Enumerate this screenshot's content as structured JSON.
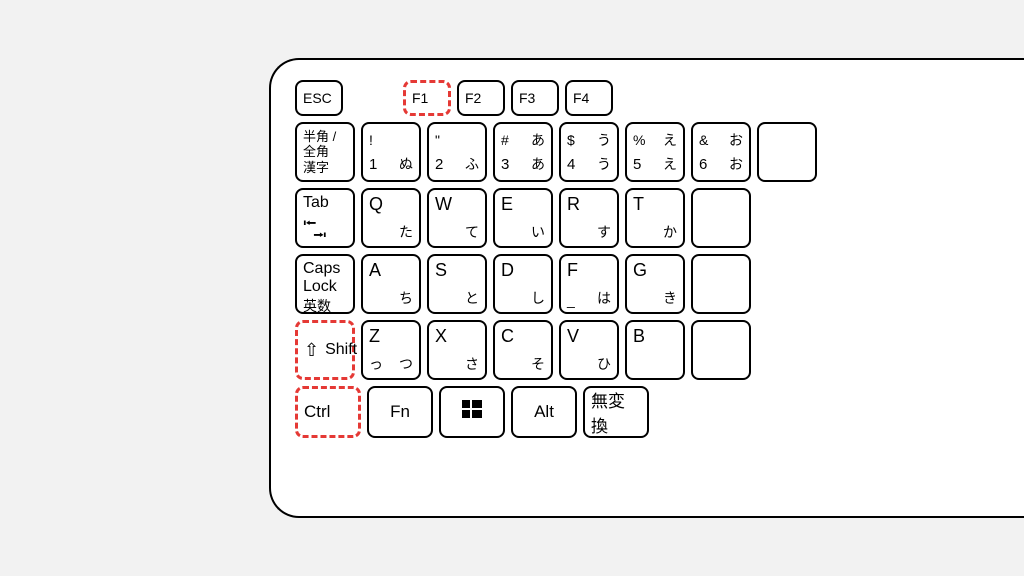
{
  "fn_row": {
    "esc": "ESC",
    "f1": "F1",
    "f2": "F2",
    "f3": "F3",
    "f4": "F4"
  },
  "num_row": {
    "hankaku": {
      "l1": "半角 /",
      "l2": "全角",
      "l3": "漢字"
    },
    "k1": {
      "tl": "!",
      "tr": "",
      "bl": "1",
      "br": "ぬ"
    },
    "k2": {
      "tl": "\"",
      "tr": "",
      "bl": "2",
      "br": "ふ"
    },
    "k3": {
      "tl": "#",
      "tr": "あ",
      "bl": "3",
      "br": "あ"
    },
    "k4": {
      "tl": "$",
      "tr": "う",
      "bl": "4",
      "br": "う"
    },
    "k5": {
      "tl": "%",
      "tr": "え",
      "bl": "5",
      "br": "え"
    },
    "k6": {
      "tl": "&",
      "tr": "お",
      "bl": "6",
      "br": "お"
    }
  },
  "qw_row": {
    "tab": "Tab",
    "tab_arrows_top": "⭰",
    "tab_arrows_bot": "⭲",
    "q": {
      "tl": "Q",
      "br": "た"
    },
    "w": {
      "tl": "W",
      "br": "て"
    },
    "e": {
      "tl": "E",
      "bl": "",
      "br": "い"
    },
    "r": {
      "tl": "R",
      "br": "す"
    },
    "t": {
      "tl": "T",
      "br": "か"
    }
  },
  "caps_row": {
    "caps_main": "Caps Lock",
    "caps_sub": "英数",
    "a": {
      "tl": "A",
      "br": "ち"
    },
    "s": {
      "tl": "S",
      "br": "と"
    },
    "d": {
      "tl": "D",
      "br": "し"
    },
    "f": {
      "tl": "F",
      "bl": "_",
      "br": "は"
    },
    "g": {
      "tl": "G",
      "br": "き"
    }
  },
  "shift_row": {
    "shift": "Shift",
    "z": {
      "tl": "Z",
      "bl": "っ",
      "br": "つ"
    },
    "x": {
      "tl": "X",
      "br": "さ"
    },
    "c": {
      "tl": "C",
      "br": "そ"
    },
    "v": {
      "tl": "V",
      "br": "ひ"
    },
    "b": {
      "tl": "B",
      "br": ""
    }
  },
  "ctrl_row": {
    "ctrl": "Ctrl",
    "fn": "Fn",
    "alt": "Alt",
    "muhenkan": "無変換"
  }
}
